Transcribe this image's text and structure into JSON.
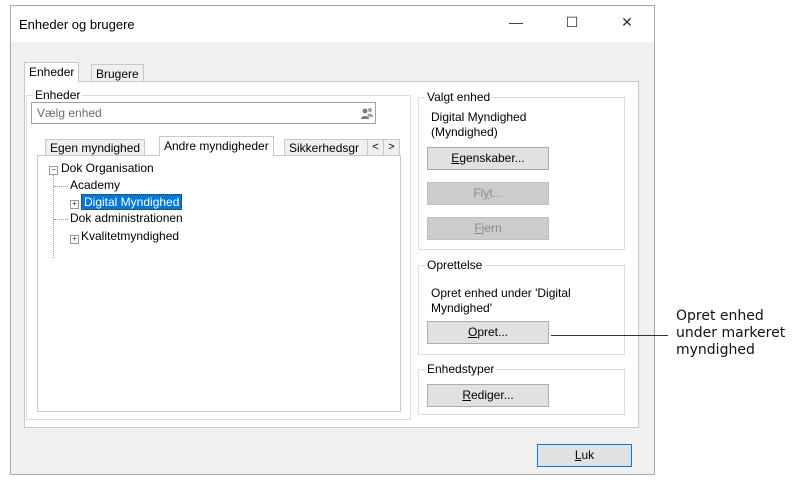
{
  "window": {
    "title": "Enheder og brugere",
    "minimize": "—",
    "maximize": "☐",
    "close": "✕"
  },
  "main_tabs": [
    {
      "label": "Enheder"
    },
    {
      "label": "Brugere"
    }
  ],
  "enheder_group": {
    "legend": "Enheder",
    "search_placeholder": "Vælg enhed",
    "search_icon": "users-icon",
    "sub_tabs": [
      {
        "label": "Egen myndighed"
      },
      {
        "label": "Andre myndigheder"
      },
      {
        "label": "Sikkerhedsgr"
      }
    ],
    "scroll_left": "<",
    "scroll_right": ">",
    "tree": {
      "root": "Dok Organisation",
      "children": [
        {
          "label": "Academy"
        },
        {
          "label": "Digital Myndighed"
        },
        {
          "label": "Dok administrationen"
        },
        {
          "label": "Kvalitetmyndighed"
        }
      ]
    }
  },
  "valgt_enhed": {
    "legend": "Valgt enhed",
    "name": "Digital Myndighed",
    "type": "(Myndighed)",
    "egenskaber_pre": "",
    "egenskaber_u": "E",
    "egenskaber_post": "genskaber...",
    "flyt_pre": "Fl",
    "flyt_u": "y",
    "flyt_post": "t...",
    "fjern_pre": "",
    "fjern_u": "F",
    "fjern_post": "jern"
  },
  "oprettelse": {
    "legend": "Oprettelse",
    "text": "Opret enhed under 'Digital Myndighed'",
    "opret_pre": "",
    "opret_u": "O",
    "opret_post": "pret..."
  },
  "enhedstyper": {
    "legend": "Enhedstyper",
    "rediger_pre": "",
    "rediger_u": "R",
    "rediger_post": "ediger..."
  },
  "footer": {
    "luk_pre": "",
    "luk_u": "L",
    "luk_post": "uk"
  },
  "annotation": {
    "line1": "Opret enhed",
    "line2": "under markeret",
    "line3": "myndighed"
  }
}
